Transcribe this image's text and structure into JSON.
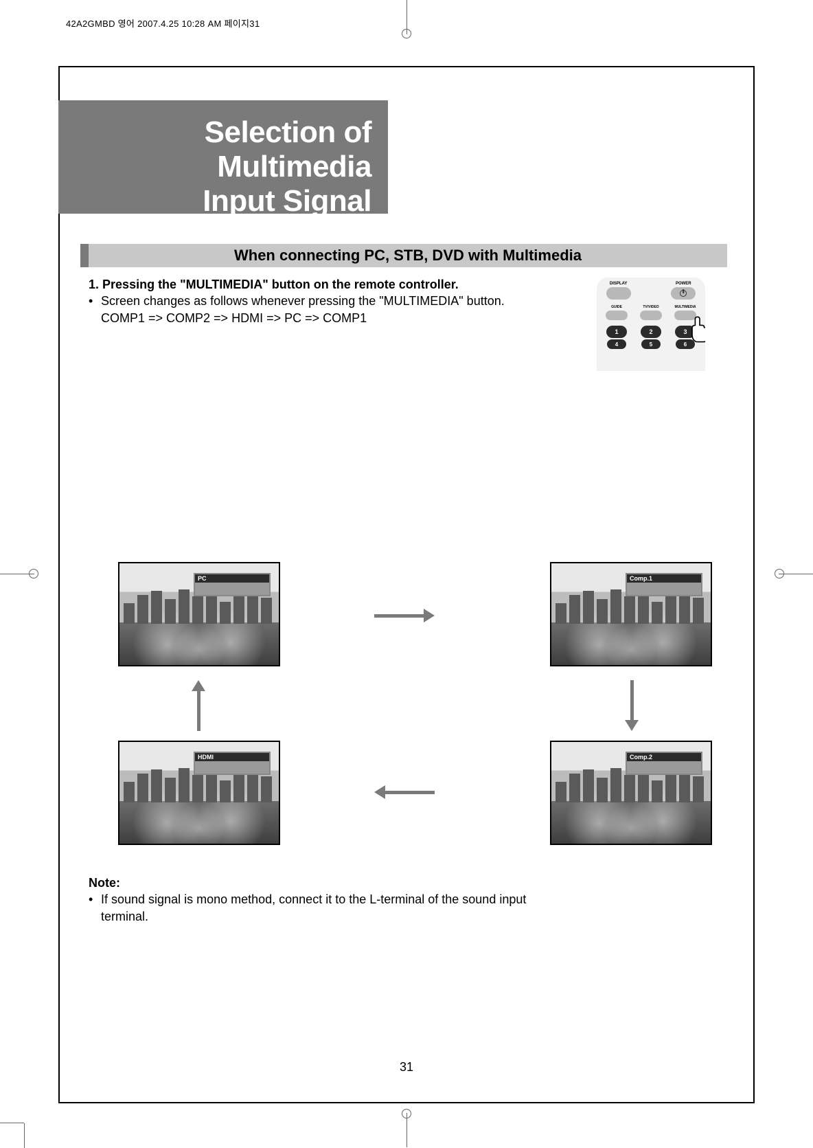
{
  "slug": "42A2GMBD  영어  2007.4.25 10:28 AM 페이지31",
  "title": {
    "line1": "Selection of Multimedia",
    "line2": "Input Signal"
  },
  "section_heading": "When connecting PC, STB, DVD with Multimedia",
  "step": {
    "num": "1.",
    "text": "Pressing the \"MULTIMEDIA\" button on the remote controller."
  },
  "bullet": {
    "dot": "•",
    "line1": "Screen changes as follows whenever pressing the \"MULTIMEDIA\" button.",
    "line2": "COMP1 => COMP2 => HDMI => PC => COMP1"
  },
  "remote": {
    "row1": {
      "left": "DISPLAY",
      "right": "POWER"
    },
    "row2": {
      "a": "GUIDE",
      "b": "TV/VIDEO",
      "c": "MULTIMEDIA"
    },
    "nums": {
      "n1": "1",
      "n2": "2",
      "n3": "3",
      "n4": "4",
      "n5": "5",
      "n6": "6"
    }
  },
  "screens": {
    "tl": "PC",
    "tr": "Comp.1",
    "bl": "HDMI",
    "br": "Comp.2"
  },
  "note": {
    "head": "Note:",
    "dot": "•",
    "text": "If sound signal is mono method, connect it to the L-terminal of the sound input terminal."
  },
  "page_number": "31"
}
